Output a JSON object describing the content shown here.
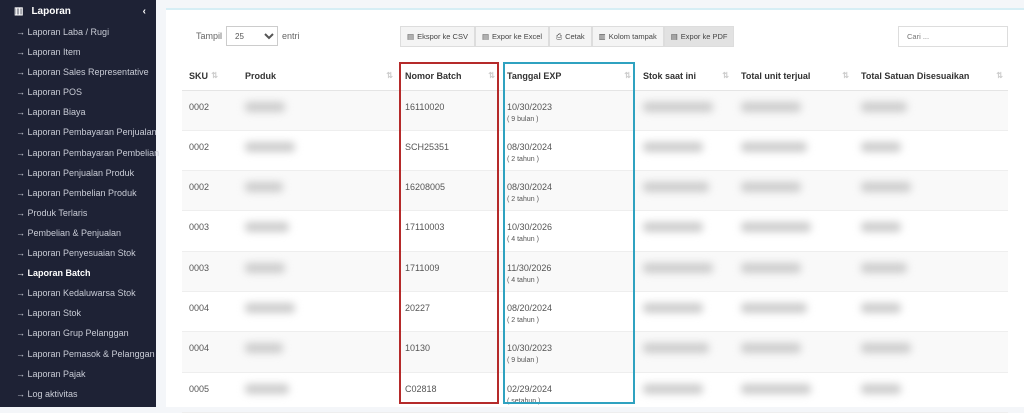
{
  "sidebar": {
    "title": "Laporan",
    "items": [
      {
        "label": "→ Laporan Laba / Rugi"
      },
      {
        "label": "→ Laporan Item"
      },
      {
        "label": "→ Laporan Sales Representative"
      },
      {
        "label": "→ Laporan POS"
      },
      {
        "label": "→ Laporan Biaya"
      },
      {
        "label": "→ Laporan Pembayaran Penjualan"
      },
      {
        "label": "→ Laporan Pembayaran Pembelian"
      },
      {
        "label": "→ Laporan Penjualan Produk"
      },
      {
        "label": "→ Laporan Pembelian Produk"
      },
      {
        "label": "→ Produk Terlaris"
      },
      {
        "label": "→ Pembelian & Penjualan"
      },
      {
        "label": "→ Laporan Penyesuaian Stok"
      },
      {
        "label": "→ Laporan Batch"
      },
      {
        "label": "→ Laporan Kedaluwarsa Stok"
      },
      {
        "label": "→ Laporan Stok"
      },
      {
        "label": "→ Laporan Grup Pelanggan"
      },
      {
        "label": "→ Laporan Pemasok & Pelanggan"
      },
      {
        "label": "→ Laporan Pajak"
      },
      {
        "label": "→ Log aktivitas"
      }
    ],
    "active_index": 12
  },
  "toolbar": {
    "show_label": "Tampil",
    "show_value": "25",
    "entries_label": "entri",
    "csv": "Ekspor ke CSV",
    "excel": "Expor ke Excel",
    "print": "Cetak",
    "columns": "Kolom tampak",
    "pdf": "Expor ke PDF",
    "search_placeholder": "Cari ..."
  },
  "table": {
    "headers": [
      "SKU",
      "Produk",
      "Nomor Batch",
      "Tanggal EXP",
      "Stok saat ini",
      "Total unit terjual",
      "Total Satuan Disesuaikan"
    ],
    "rows": [
      {
        "sku": "0002",
        "batch": "16110020",
        "exp": "10/30/2023",
        "exp_note": "( 9 bulan )"
      },
      {
        "sku": "0002",
        "batch": "SCH25351",
        "exp": "08/30/2024",
        "exp_note": "( 2 tahun )"
      },
      {
        "sku": "0002",
        "batch": "16208005",
        "exp": "08/30/2024",
        "exp_note": "( 2 tahun )"
      },
      {
        "sku": "0003",
        "batch": "17110003",
        "exp": "10/30/2026",
        "exp_note": "( 4 tahun )"
      },
      {
        "sku": "0003",
        "batch": "1711009",
        "exp": "11/30/2026",
        "exp_note": "( 4 tahun )"
      },
      {
        "sku": "0004",
        "batch": "20227",
        "exp": "08/20/2024",
        "exp_note": "( 2 tahun )"
      },
      {
        "sku": "0004",
        "batch": "10130",
        "exp": "10/30/2023",
        "exp_note": "( 9 bulan )"
      },
      {
        "sku": "0005",
        "batch": "C02818",
        "exp": "02/29/2024",
        "exp_note": "( setahun )"
      }
    ]
  },
  "highlights": {
    "batch_color": "#b52a2a",
    "exp_color": "#2fa2c0"
  }
}
